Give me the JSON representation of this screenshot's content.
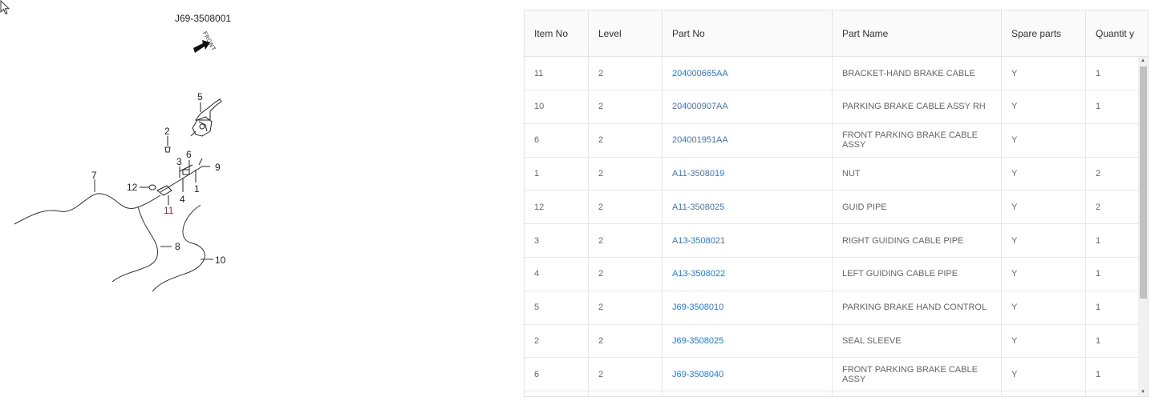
{
  "diagram": {
    "title": "J69-3508001",
    "front_label": "FRONT",
    "callouts": [
      {
        "id": "5",
        "label": "5"
      },
      {
        "id": "2",
        "label": "2"
      },
      {
        "id": "6",
        "label": "6"
      },
      {
        "id": "3",
        "label": "3"
      },
      {
        "id": "9",
        "label": "9"
      },
      {
        "id": "7",
        "label": "7"
      },
      {
        "id": "12",
        "label": "12"
      },
      {
        "id": "1",
        "label": "1"
      },
      {
        "id": "4",
        "label": "4"
      },
      {
        "id": "11",
        "label": "11"
      },
      {
        "id": "8",
        "label": "8"
      },
      {
        "id": "10",
        "label": "10"
      }
    ]
  },
  "table": {
    "headers": [
      "Item No",
      "Level",
      "Part No",
      "Part Name",
      "Spare parts",
      "Quantit y"
    ],
    "rows": [
      {
        "item": "11",
        "level": "2",
        "part_no": "204000665AA",
        "part_name": "BRACKET-HAND BRAKE CABLE",
        "spare": "Y",
        "qty": "1"
      },
      {
        "item": "10",
        "level": "2",
        "part_no": "204000907AA",
        "part_name": "PARKING BRAKE CABLE ASSY RH",
        "spare": "Y",
        "qty": "1"
      },
      {
        "item": "6",
        "level": "2",
        "part_no": "204001951AA",
        "part_name": "FRONT PARKING BRAKE CABLE ASSY",
        "spare": "Y",
        "qty": ""
      },
      {
        "item": "1",
        "level": "2",
        "part_no": "A11-3508019",
        "part_name": "NUT",
        "spare": "Y",
        "qty": "2"
      },
      {
        "item": "12",
        "level": "2",
        "part_no": "A11-3508025",
        "part_name": "GUID PIPE",
        "spare": "Y",
        "qty": "2"
      },
      {
        "item": "3",
        "level": "2",
        "part_no": "A13-3508021",
        "part_name": "RIGHT GUIDING CABLE PIPE",
        "spare": "Y",
        "qty": "1"
      },
      {
        "item": "4",
        "level": "2",
        "part_no": "A13-3508022",
        "part_name": "LEFT GUIDING CABLE PIPE",
        "spare": "Y",
        "qty": "1"
      },
      {
        "item": "5",
        "level": "2",
        "part_no": "J69-3508010",
        "part_name": "PARKING BRAKE HAND CONTROL",
        "spare": "Y",
        "qty": "1"
      },
      {
        "item": "2",
        "level": "2",
        "part_no": "J69-3508025",
        "part_name": "SEAL SLEEVE",
        "spare": "Y",
        "qty": "1"
      },
      {
        "item": "6",
        "level": "2",
        "part_no": "J69-3508040",
        "part_name": "FRONT PARKING BRAKE CABLE ASSY",
        "spare": "Y",
        "qty": "1"
      },
      {
        "item": "",
        "level": "",
        "part_no": "",
        "part_name": "",
        "spare": "",
        "qty": ""
      }
    ]
  }
}
